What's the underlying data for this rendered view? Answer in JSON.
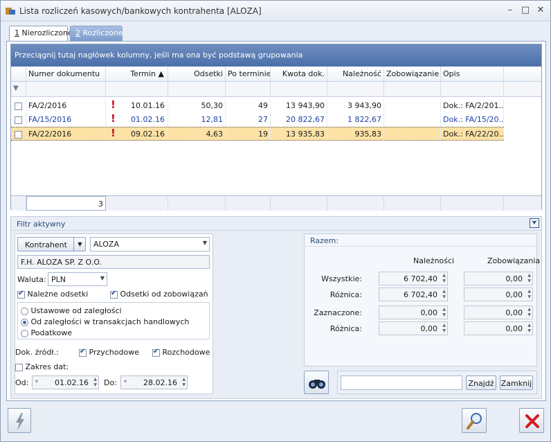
{
  "window": {
    "title": "Lista rozliczeń kasowych/bankowych kontrahenta [ALOZA]",
    "min": "–",
    "max": "□",
    "close": "✕"
  },
  "tabs": [
    {
      "num": "1",
      "label": "Nierozliczone"
    },
    {
      "num": "2",
      "label": "Rozliczone"
    }
  ],
  "grid": {
    "group_hint": "Przeciągnij tutaj nagłówek kolumny, jeśli ma ona być podstawą grupowania",
    "columns": [
      "Numer dokumentu",
      "Termin",
      "Odsetki",
      "Po terminie",
      "Kwota dok.",
      "Należność",
      "Zobowiązanie",
      "Opis"
    ],
    "sort_arrow": "▲",
    "rows": [
      {
        "doc": "FA/2/2016",
        "termin": "10.01.16",
        "odsetki": "50,30",
        "po": "49",
        "kwota": "13 943,90",
        "naleznosc": "3 943,90",
        "zob": "",
        "opis": "Dok.: FA/2/201..."
      },
      {
        "doc": "FA/15/2016",
        "termin": "01.02.16",
        "odsetki": "12,81",
        "po": "27",
        "kwota": "20 822,67",
        "naleznosc": "1 822,67",
        "zob": "",
        "opis": "Dok.: FA/15/20..."
      },
      {
        "doc": "FA/22/2016",
        "termin": "09.02.16",
        "odsetki": "4,63",
        "po": "19",
        "kwota": "13 935,83",
        "naleznosc": "935,83",
        "zob": "",
        "opis": "Dok.: FA/22/20..."
      }
    ],
    "footer_count": "3"
  },
  "filter": {
    "header": "Filtr aktywny",
    "kontrahent_btn": "Kontrahent",
    "kontrahent_code": "ALOZA",
    "kontrahent_name": "F.H. ALOZA SP. Z O.O.",
    "waluta_label": "Waluta:",
    "waluta_value": "PLN",
    "nalezne_odsetki": "Należne odsetki",
    "odsetki_zob": "Odsetki od zobowiązań",
    "radios": [
      "Ustawowe od zaległości",
      "Od zaległości w transakcjach handlowych",
      "Podatkowe"
    ],
    "dok_zrodl": "Dok. źródł.:",
    "przychodowe": "Przychodowe",
    "rozchodowe": "Rozchodowe",
    "zakres_dat": "Zakres dat:",
    "od_label": "Od:",
    "od_value": "01.02.16",
    "do_label": "Do:",
    "do_value": "28.02.16"
  },
  "razem": {
    "title": "Razem:",
    "col_naleznosci": "Należności",
    "col_zobowiazania": "Zobowiązania",
    "rows": [
      {
        "label": "Wszystkie:",
        "n": "6 702,40",
        "z": "0,00"
      },
      {
        "label": "Różnica:",
        "n": "6 702,40",
        "z": "0,00"
      },
      {
        "label": "Zaznaczone:",
        "n": "0,00",
        "z": "0,00"
      },
      {
        "label": "Różnica:",
        "n": "0,00",
        "z": "0,00"
      }
    ]
  },
  "search": {
    "value": "",
    "find_btn": "Znajdź",
    "close_btn": "Zamknij"
  }
}
